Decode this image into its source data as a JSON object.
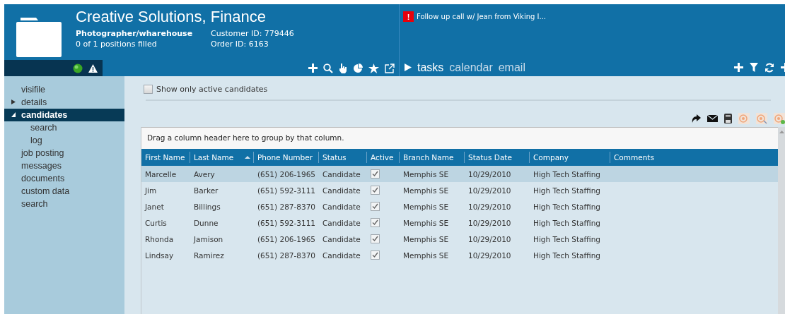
{
  "header": {
    "title": "Creative Solutions, Finance",
    "position": "Photographer/wharehouse",
    "positions_filled": "0 of 1 positions filled",
    "customer_id": "Customer ID: 779446",
    "order_id": "Order ID: 6163"
  },
  "alert": {
    "badge": "!",
    "text": "Follow up call w/ Jean from Viking I..."
  },
  "tabs": [
    {
      "label": "tasks",
      "selected": true
    },
    {
      "label": "calendar",
      "selected": false
    },
    {
      "label": "email",
      "selected": false
    }
  ],
  "sidebar": {
    "items": [
      {
        "label": "visifile",
        "selected": false
      },
      {
        "label": "details",
        "selected": false,
        "expanded": false
      },
      {
        "label": "candidates",
        "selected": true,
        "expanded": true,
        "children": [
          {
            "label": "search",
            "selected": false
          },
          {
            "label": "log",
            "selected": false
          }
        ]
      },
      {
        "label": "job posting",
        "selected": false
      },
      {
        "label": "messages",
        "selected": false
      },
      {
        "label": "documents",
        "selected": false
      },
      {
        "label": "custom data",
        "selected": false
      },
      {
        "label": "search",
        "selected": false
      }
    ]
  },
  "filter": {
    "label": "Show only active candidates",
    "checked": false
  },
  "grid": {
    "group_hint": "Drag a column header here to group by that column.",
    "columns": [
      {
        "label": "First Name",
        "sorted": false
      },
      {
        "label": "Last Name",
        "sorted": true
      },
      {
        "label": "Phone Number",
        "sorted": false
      },
      {
        "label": "Status",
        "sorted": false
      },
      {
        "label": "Active",
        "sorted": false
      },
      {
        "label": "Branch Name",
        "sorted": false
      },
      {
        "label": "Status Date",
        "sorted": false
      },
      {
        "label": "Company",
        "sorted": false
      },
      {
        "label": "Comments",
        "sorted": false
      }
    ],
    "rows": [
      {
        "selected": true,
        "first": "Marcelle",
        "last": "Avery",
        "phone": "(651) 206-1965",
        "status": "Candidate",
        "active": true,
        "branch": "Memphis SE",
        "date": "10/29/2010",
        "company": "High Tech Staffing"
      },
      {
        "selected": false,
        "first": "Jim",
        "last": "Barker",
        "phone": "(651) 592-3111",
        "status": "Candidate",
        "active": true,
        "branch": "Memphis SE",
        "date": "10/29/2010",
        "company": "High Tech Staffing"
      },
      {
        "selected": false,
        "first": "Janet",
        "last": "Billings",
        "phone": "(651) 287-8370",
        "status": "Candidate",
        "active": true,
        "branch": "Memphis SE",
        "date": "10/29/2010",
        "company": "High Tech Staffing"
      },
      {
        "selected": false,
        "first": "Curtis",
        "last": "Dunne",
        "phone": "(651) 592-3111",
        "status": "Candidate",
        "active": true,
        "branch": "Memphis SE",
        "date": "10/29/2010",
        "company": "High Tech Staffing"
      },
      {
        "selected": false,
        "first": "Rhonda",
        "last": "Jamison",
        "phone": "(651) 206-1965",
        "status": "Candidate",
        "active": true,
        "branch": "Memphis SE",
        "date": "10/29/2010",
        "company": "High Tech Staffing"
      },
      {
        "selected": false,
        "first": "Lindsay",
        "last": "Ramirez",
        "phone": "(651) 287-8370",
        "status": "Candidate",
        "active": true,
        "branch": "Memphis SE",
        "date": "10/29/2010",
        "company": "High Tech Staffing"
      }
    ]
  }
}
